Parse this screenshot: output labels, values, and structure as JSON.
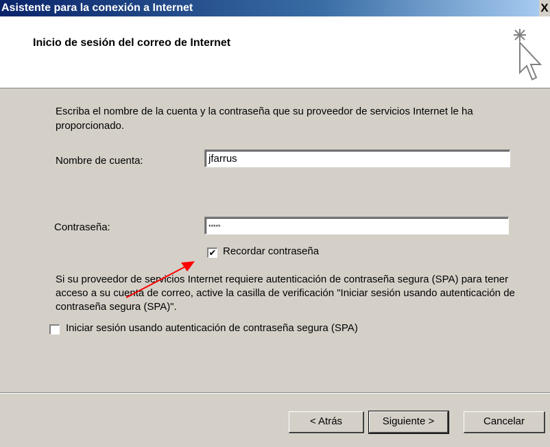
{
  "window": {
    "title": "Asistente para la conexión a Internet",
    "close_label": "X"
  },
  "header": {
    "title": "Inicio de sesión del correo de Internet",
    "icon": "wizard-cursor-icon"
  },
  "intro_text": "Escriba el nombre de la cuenta y la contraseña que su proveedor de servicios Internet le ha proporcionado.",
  "account": {
    "label": "Nombre de cuenta:",
    "value": "jfarrus"
  },
  "password": {
    "label": "Contraseña:",
    "value": "*****"
  },
  "remember": {
    "label": "Recordar contraseña",
    "checked": true,
    "mark": "✔"
  },
  "spa_info": "Si su proveedor de servicios Internet requiere autenticación de contraseña segura (SPA) para tener acceso a su cuenta de correo, active la casilla de verificación \"Iniciar sesión usando autenticación de contraseña segura (SPA)\".",
  "spa_checkbox": {
    "label": "Iniciar sesión usando autenticación de contraseña segura (SPA)",
    "checked": false
  },
  "buttons": {
    "back": "< Atrás",
    "next": "Siguiente >",
    "cancel": "Cancelar"
  },
  "colors": {
    "titlebar": "#0a246a",
    "face": "#d4d0c8",
    "annotation_arrow": "#ff0000"
  }
}
